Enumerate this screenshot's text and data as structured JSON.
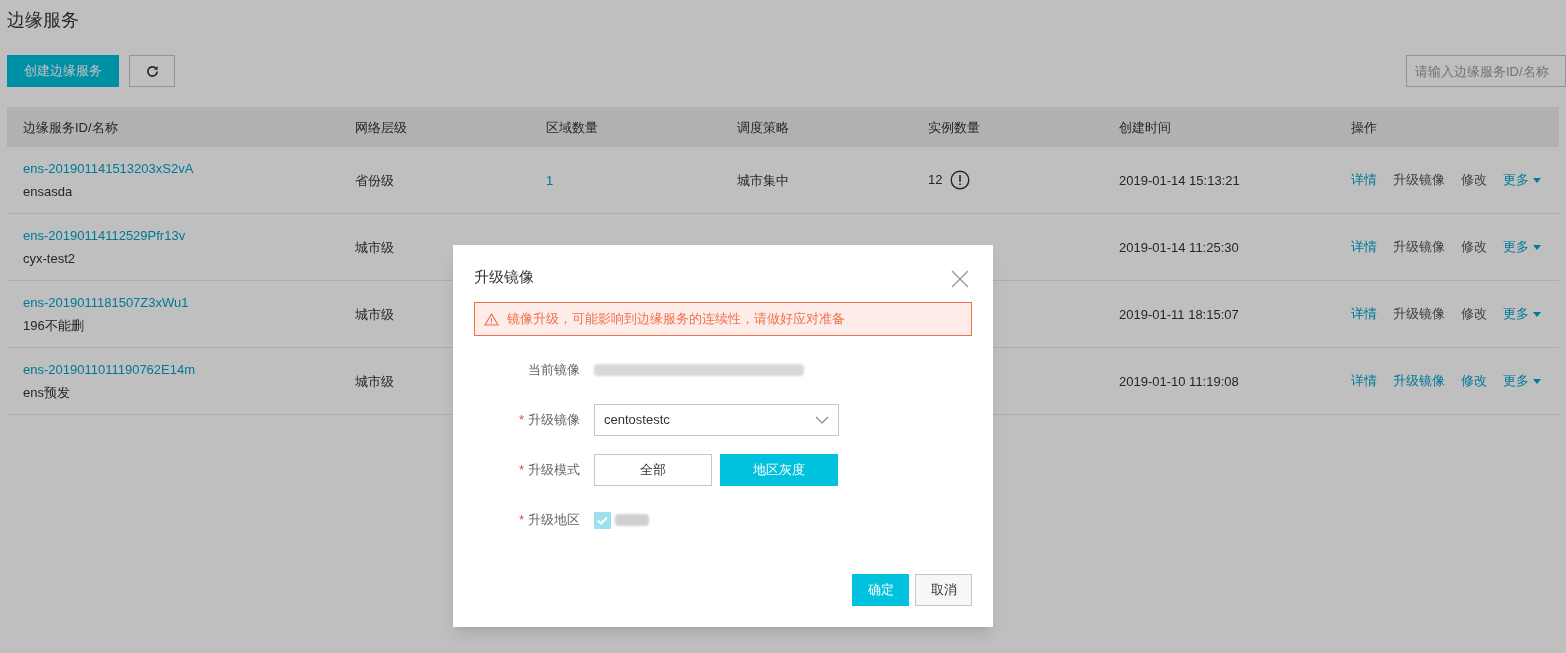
{
  "page_title": "边缘服务",
  "toolbar": {
    "create_button": "创建边缘服务",
    "search": {
      "placeholder": "请输入边缘服务ID/名称"
    }
  },
  "table": {
    "columns": [
      "边缘服务ID/名称",
      "网络层级",
      "区域数量",
      "调度策略",
      "实例数量",
      "创建时间",
      "操作"
    ],
    "rows": [
      {
        "id": "ens-201901141513203xS2vA",
        "name": "ensasda",
        "level": "省份级",
        "regions": "1",
        "strategy": "城市集中",
        "instances": "12",
        "warning": true,
        "created": "2019-01-14 15:13:21",
        "actions": [
          {
            "label": "详情",
            "disabled": false
          },
          {
            "label": "升级镜像",
            "disabled": true
          },
          {
            "label": "修改",
            "disabled": true
          },
          {
            "label": "更多",
            "disabled": false,
            "kind": "menu"
          }
        ]
      },
      {
        "id": "ens-20190114112529Pfr13v",
        "name": "cyx-test2",
        "level": "城市级",
        "created": "2019-01-14 11:25:30",
        "actions": [
          {
            "label": "详情",
            "disabled": false
          },
          {
            "label": "升级镜像",
            "disabled": true
          },
          {
            "label": "修改",
            "disabled": true
          },
          {
            "label": "更多",
            "disabled": false,
            "kind": "menu"
          }
        ]
      },
      {
        "id": "ens-2019011181507Z3xWu1",
        "name": "196不能删",
        "level": "城市级",
        "created": "2019-01-11 18:15:07",
        "actions": [
          {
            "label": "详情",
            "disabled": false
          },
          {
            "label": "升级镜像",
            "disabled": true
          },
          {
            "label": "修改",
            "disabled": true
          },
          {
            "label": "更多",
            "disabled": false,
            "kind": "menu"
          }
        ]
      },
      {
        "id": "ens-2019011011190762E14m",
        "name": "ens预发",
        "level": "城市级",
        "created": "2019-01-10 11:19:08",
        "actions": [
          {
            "label": "详情",
            "disabled": false
          },
          {
            "label": "升级镜像",
            "disabled": false
          },
          {
            "label": "修改",
            "disabled": false
          },
          {
            "label": "更多",
            "disabled": false,
            "kind": "menu"
          }
        ]
      }
    ]
  },
  "dialog": {
    "title": "升级镜像",
    "alert": "镜像升级，可能影响到边缘服务的连续性，请做好应对准备",
    "fields": [
      {
        "kind": "redacted",
        "label": "当前镜像"
      },
      {
        "kind": "select",
        "label": "升级镜像",
        "required_mark": "*",
        "value": "centostestc"
      },
      {
        "kind": "segmented",
        "label": "升级模式",
        "required_mark": "*",
        "options": [
          {
            "label": "全部",
            "selected": false
          },
          {
            "label": "地区灰度",
            "selected": true
          }
        ]
      },
      {
        "kind": "checkbox",
        "label": "升级地区",
        "required_mark": "*",
        "checked": true
      }
    ],
    "buttons": [
      {
        "label": "确定",
        "primary": true
      },
      {
        "label": "取消",
        "primary": false
      }
    ]
  }
}
